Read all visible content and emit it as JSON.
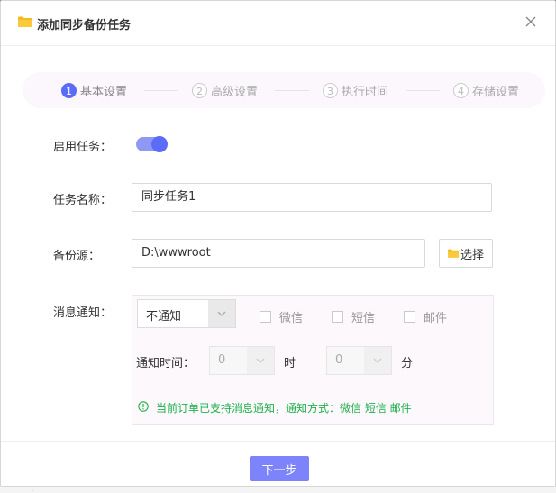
{
  "dialog": {
    "title": "添加同步备份任务"
  },
  "steps": [
    {
      "num": "1",
      "label": "基本设置",
      "active": true
    },
    {
      "num": "2",
      "label": "高级设置",
      "active": false
    },
    {
      "num": "3",
      "label": "执行时间",
      "active": false
    },
    {
      "num": "4",
      "label": "存储设置",
      "active": false
    }
  ],
  "form": {
    "enable_label": "启用任务：",
    "enable_on": true,
    "name_label": "任务名称：",
    "name_value": "同步任务1",
    "source_label": "备份源：",
    "source_value": "D:\\wwwroot",
    "choose_label": "选择",
    "notify_label": "消息通知："
  },
  "notify": {
    "type_value": "不通知",
    "channels": [
      "微信",
      "短信",
      "邮件"
    ],
    "time_label": "通知时间：",
    "hour_value": "0",
    "hour_unit": "时",
    "minute_value": "0",
    "minute_unit": "分",
    "info": "当前订单已支持消息通知，通知方式：微信 短信 邮件"
  },
  "footer": {
    "next_label": "下一步"
  },
  "colors": {
    "primary": "#5b6cf9",
    "button": "#7d84fb",
    "success": "#22b14c",
    "folder": "#f5b820"
  }
}
